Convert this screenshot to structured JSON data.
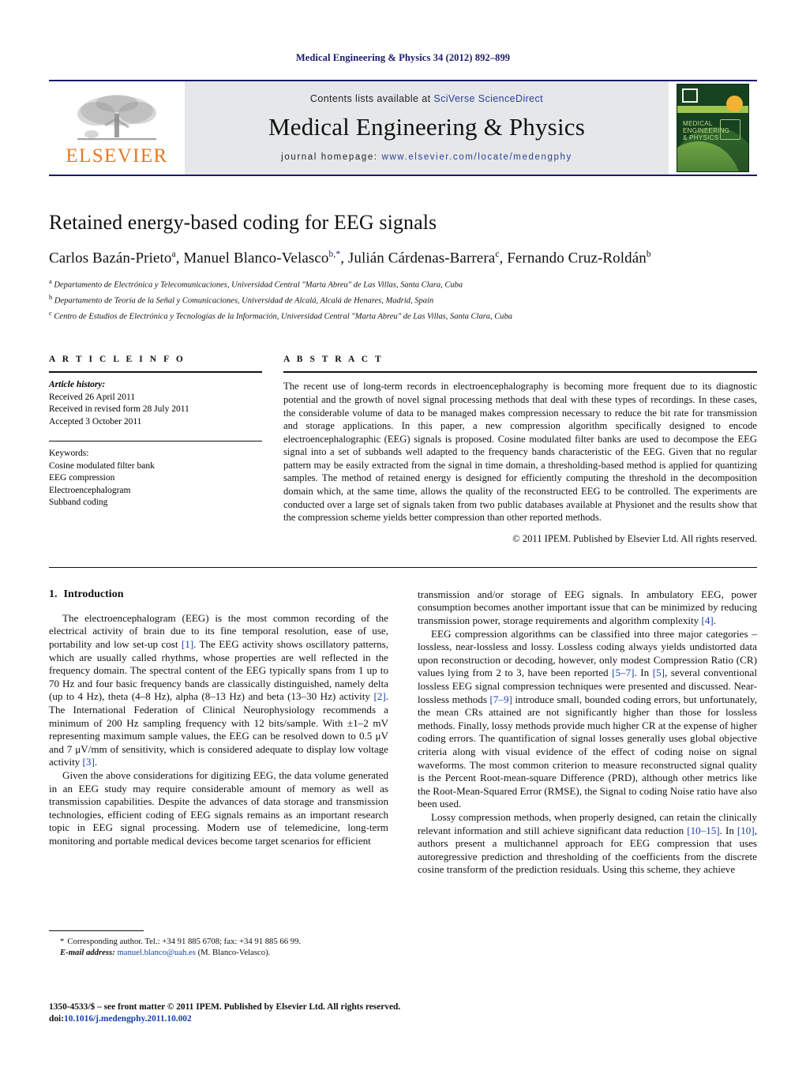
{
  "running_head": "Medical Engineering & Physics 34 (2012) 892–899",
  "masthead": {
    "contents_prefix": "Contents lists available at ",
    "contents_link": "SciVerse ScienceDirect",
    "journal_title": "Medical Engineering & Physics",
    "homepage_prefix": "journal homepage: ",
    "homepage_url": "www.elsevier.com/locate/medengphy",
    "publisher_logo_text": "ELSEVIER",
    "cover_title": "MEDICAL ENGINEERING & PHYSICS",
    "brand_orange": "#E87722",
    "brand_navy": "#1a1a6e",
    "link_blue": "#2a3f9d"
  },
  "article": {
    "title": "Retained energy-based coding for EEG signals",
    "authors_html": "Carlos Bazán-Prieto, Manuel Blanco-Velasco, Julián Cárdenas-Barrera, Fernando Cruz-Roldán",
    "authors": [
      {
        "name": "Carlos Bazán-Prieto",
        "marks": "a"
      },
      {
        "name": "Manuel Blanco-Velasco",
        "marks": "b,*"
      },
      {
        "name": "Julián Cárdenas-Barrera",
        "marks": "c"
      },
      {
        "name": "Fernando Cruz-Roldán",
        "marks": "b"
      }
    ],
    "affiliations": [
      {
        "mark": "a",
        "text": "Departamento de Electrónica y Telecomunicaciones, Universidad Central \"Marta Abreu\" de Las Villas, Santa Clara, Cuba"
      },
      {
        "mark": "b",
        "text": "Departamento de Teoría de la Señal y Comunicaciones, Universidad de Alcalá, Alcalá de Henares, Madrid, Spain"
      },
      {
        "mark": "c",
        "text": "Centro de Estudios de Electrónica y Tecnologías de la Información, Universidad Central \"Marta Abreu\" de Las Villas, Santa Clara, Cuba"
      }
    ]
  },
  "article_info": {
    "heading": "A R T I C L E   I N F O",
    "history_label": "Article history:",
    "history": [
      "Received 26 April 2011",
      "Received in revised form 28 July 2011",
      "Accepted 3 October 2011"
    ],
    "keywords_label": "Keywords:",
    "keywords": [
      "Cosine modulated filter bank",
      "EEG compression",
      "Electroencephalogram",
      "Subband coding"
    ]
  },
  "abstract": {
    "heading": "A B S T R A C T",
    "text": "The recent use of long-term records in electroencephalography is becoming more frequent due to its diagnostic potential and the growth of novel signal processing methods that deal with these types of recordings. In these cases, the considerable volume of data to be managed makes compression necessary to reduce the bit rate for transmission and storage applications. In this paper, a new compression algorithm specifically designed to encode electroencephalographic (EEG) signals is proposed. Cosine modulated filter banks are used to decompose the EEG signal into a set of subbands well adapted to the frequency bands characteristic of the EEG. Given that no regular pattern may be easily extracted from the signal in time domain, a thresholding-based method is applied for quantizing samples. The method of retained energy is designed for efficiently computing the threshold in the decomposition domain which, at the same time, allows the quality of the reconstructed EEG to be controlled. The experiments are conducted over a large set of signals taken from two public databases available at Physionet and the results show that the compression scheme yields better compression than other reported methods.",
    "copyright": "© 2011 IPEM. Published by Elsevier Ltd. All rights reserved."
  },
  "body": {
    "section_number": "1.",
    "section_title": "Introduction",
    "left_paragraphs": [
      "The electroencephalogram (EEG) is the most common recording of the electrical activity of brain due to its fine temporal resolution, ease of use, portability and low set-up cost [1]. The EEG activity shows oscillatory patterns, which are usually called rhythms, whose properties are well reflected in the frequency domain. The spectral content of the EEG typically spans from 1 up to 70 Hz and four basic frequency bands are classically distinguished, namely delta (up to 4 Hz), theta (4–8 Hz), alpha (8–13 Hz) and beta (13–30 Hz) activity [2]. The International Federation of Clinical Neurophysiology recommends a minimum of 200 Hz sampling frequency with 12 bits/sample. With ±1–2 mV representing maximum sample values, the EEG can be resolved down to 0.5 μV and 7 μV/mm of sensitivity, which is considered adequate to display low voltage activity [3].",
      "Given the above considerations for digitizing EEG, the data volume generated in an EEG study may require considerable amount of memory as well as transmission capabilities. Despite the advances of data storage and transmission technologies, efficient coding of EEG signals remains as an important research topic in EEG signal processing. Modern use of telemedicine, long-term monitoring and portable medical devices become target scenarios for efficient"
    ],
    "right_paragraphs": [
      "transmission and/or storage of EEG signals. In ambulatory EEG, power consumption becomes another important issue that can be minimized by reducing transmission power, storage requirements and algorithm complexity [4].",
      "EEG compression algorithms can be classified into three major categories – lossless, near-lossless and lossy. Lossless coding always yields undistorted data upon reconstruction or decoding, however, only modest Compression Ratio (CR) values lying from 2 to 3, have been reported [5–7]. In [5], several conventional lossless EEG signal compression techniques were presented and discussed. Near-lossless methods [7–9] introduce small, bounded coding errors, but unfortunately, the mean CRs attained are not significantly higher than those for lossless methods. Finally, lossy methods provide much higher CR at the expense of higher coding errors. The quantification of signal losses generally uses global objective criteria along with visual evidence of the effect of coding noise on signal waveforms. The most common criterion to measure reconstructed signal quality is the Percent Root-mean-square Difference (PRD), although other metrics like the Root-Mean-Squared Error (RMSE), the Signal to coding Noise ratio have also been used.",
      "Lossy compression methods, when properly designed, can retain the clinically relevant information and still achieve significant data reduction [10–15]. In [10], authors present a multichannel approach for EEG compression that uses autoregressive prediction and thresholding of the coefficients from the discrete cosine transform of the prediction residuals. Using this scheme, they achieve"
    ]
  },
  "footnotes": {
    "corresponding": "Corresponding author. Tel.: +34 91 885 6708; fax: +34 91 885 66 99.",
    "email_label": "E-mail address:",
    "email": "manuel.blanco@uah.es",
    "email_owner": "(M. Blanco-Velasco)."
  },
  "imprint": {
    "line1": "1350-4533/$ – see front matter © 2011 IPEM. Published by Elsevier Ltd. All rights reserved.",
    "doi_label": "doi:",
    "doi": "10.1016/j.medengphy.2011.10.002"
  }
}
